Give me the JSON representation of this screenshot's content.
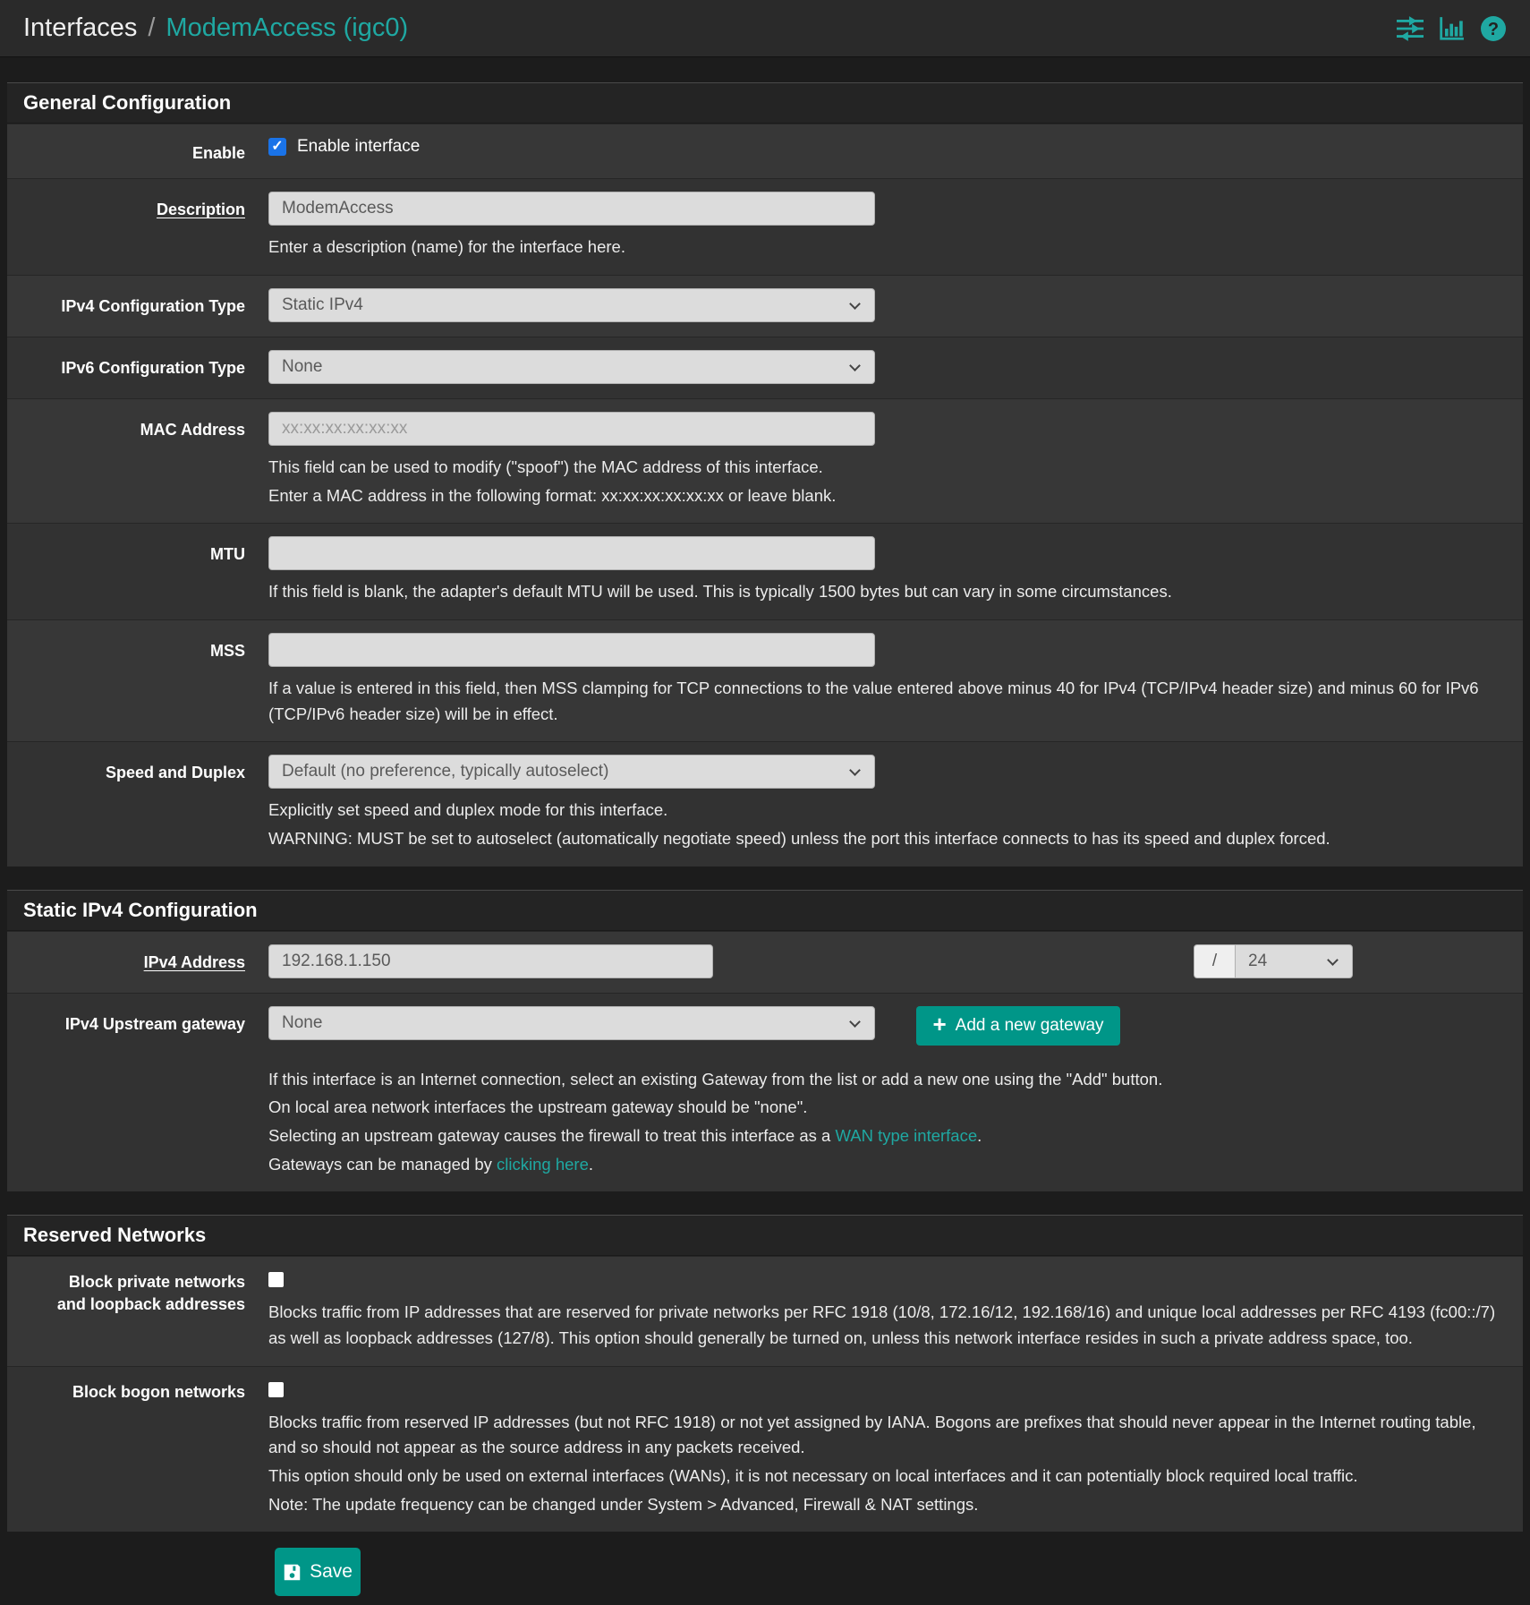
{
  "colors": {
    "accent_teal": "#1fa8a2",
    "button_teal": "#009688",
    "checkbox_checked_blue": "#1a73e8",
    "panel_background": "#333333",
    "page_background": "#1c1c1c"
  },
  "breadcrumb": {
    "section": "Interfaces",
    "sep": "/",
    "page": "ModemAccess (igc0)"
  },
  "nav_icons": [
    "sliders-icon",
    "bar-chart-icon",
    "question-icon"
  ],
  "general": {
    "title": "General Configuration",
    "enable": {
      "label": "Enable",
      "checkbox_label": "Enable interface",
      "checked": true
    },
    "description": {
      "label": "Description",
      "value": "ModemAccess",
      "help": "Enter a description (name) for the interface here."
    },
    "ipv4_type": {
      "label": "IPv4 Configuration Type",
      "value": "Static IPv4"
    },
    "ipv6_type": {
      "label": "IPv6 Configuration Type",
      "value": "None"
    },
    "mac": {
      "label": "MAC Address",
      "placeholder": "xx:xx:xx:xx:xx:xx",
      "help1": "This field can be used to modify (\"spoof\") the MAC address of this interface.",
      "help2": "Enter a MAC address in the following format: xx:xx:xx:xx:xx:xx or leave blank."
    },
    "mtu": {
      "label": "MTU",
      "value": "",
      "help": "If this field is blank, the adapter's default MTU will be used. This is typically 1500 bytes but can vary in some circumstances."
    },
    "mss": {
      "label": "MSS",
      "value": "",
      "help": "If a value is entered in this field, then MSS clamping for TCP connections to the value entered above minus 40 for IPv4 (TCP/IPv4 header size) and minus 60 for IPv6 (TCP/IPv6 header size) will be in effect."
    },
    "speed": {
      "label": "Speed and Duplex",
      "value": "Default (no preference, typically autoselect)",
      "help1": "Explicitly set speed and duplex mode for this interface.",
      "help2": "WARNING: MUST be set to autoselect (automatically negotiate speed) unless the port this interface connects to has its speed and duplex forced."
    }
  },
  "static4": {
    "title": "Static IPv4 Configuration",
    "address": {
      "label": "IPv4 Address",
      "value": "192.168.1.150",
      "mask_sep": "/",
      "mask": "24"
    },
    "gateway": {
      "label": "IPv4 Upstream gateway",
      "value": "None",
      "add_button": "Add a new gateway",
      "help1": "If this interface is an Internet connection, select an existing Gateway from the list or add a new one using the \"Add\" button.",
      "help2": "On local area network interfaces the upstream gateway should be \"none\".",
      "help3_pre": "Selecting an upstream gateway causes the firewall to treat this interface as a ",
      "help3_link": "WAN type interface",
      "help3_post": ".",
      "help4_pre": "Gateways can be managed by ",
      "help4_link": "clicking here",
      "help4_post": "."
    }
  },
  "reserved": {
    "title": "Reserved Networks",
    "private": {
      "label1": "Block private networks",
      "label2": "and loopback addresses",
      "checked": false,
      "help": "Blocks traffic from IP addresses that are reserved for private networks per RFC 1918 (10/8, 172.16/12, 192.168/16) and unique local addresses per RFC 4193 (fc00::/7) as well as loopback addresses (127/8). This option should generally be turned on, unless this network interface resides in such a private address space, too."
    },
    "bogon": {
      "label": "Block bogon networks",
      "checked": false,
      "help1": "Blocks traffic from reserved IP addresses (but not RFC 1918) or not yet assigned by IANA. Bogons are prefixes that should never appear in the Internet routing table, and so should not appear as the source address in any packets received.",
      "help2": "This option should only be used on external interfaces (WANs), it is not necessary on local interfaces and it can potentially block required local traffic.",
      "help3": "Note: The update frequency can be changed under System > Advanced, Firewall & NAT settings."
    }
  },
  "footer": {
    "save": "Save"
  }
}
